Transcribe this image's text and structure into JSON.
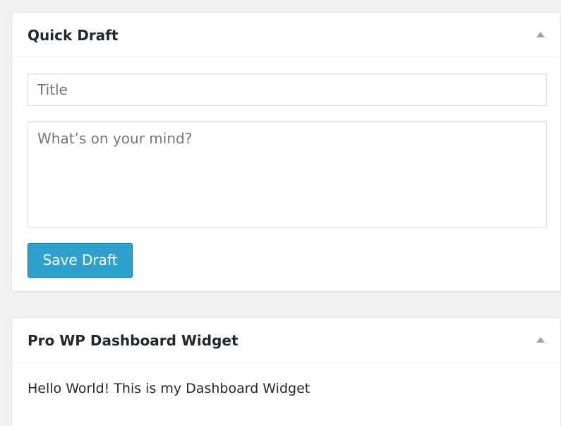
{
  "quick_draft": {
    "title": "Quick Draft",
    "title_placeholder": "Title",
    "content_placeholder": "What’s on your mind?",
    "save_label": "Save Draft",
    "toggle_icon": "triangle-up-icon"
  },
  "pro_widget": {
    "title": "Pro WP Dashboard Widget",
    "body_text": "Hello World! This is my Dashboard Widget",
    "toggle_icon": "triangle-up-icon"
  },
  "colors": {
    "background": "#f1f1f1",
    "panel": "#ffffff",
    "button": "#2ea2cc",
    "button_border": "#0074a2",
    "toggle": "#a0a5aa"
  }
}
